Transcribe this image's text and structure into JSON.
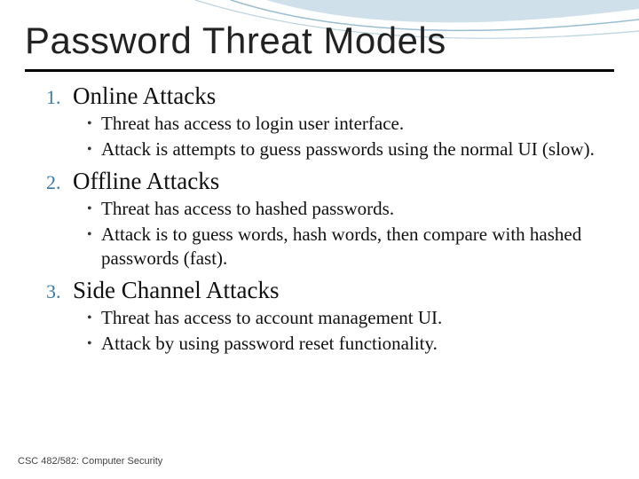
{
  "title": "Password Threat Models",
  "items": [
    {
      "num": "1.",
      "label": "Online Attacks",
      "bullets": [
        "Threat has access to login user interface.",
        "Attack is attempts to guess passwords using the normal UI (slow)."
      ]
    },
    {
      "num": "2.",
      "label": "Offline Attacks",
      "bullets": [
        "Threat has access to hashed passwords.",
        "Attack is to guess words, hash words, then compare with hashed passwords (fast)."
      ]
    },
    {
      "num": "3.",
      "label": "Side Channel Attacks",
      "bullets": [
        "Threat has access to account management UI.",
        "Attack by using password reset functionality."
      ]
    }
  ],
  "footer": "CSC 482/582: Computer Security"
}
